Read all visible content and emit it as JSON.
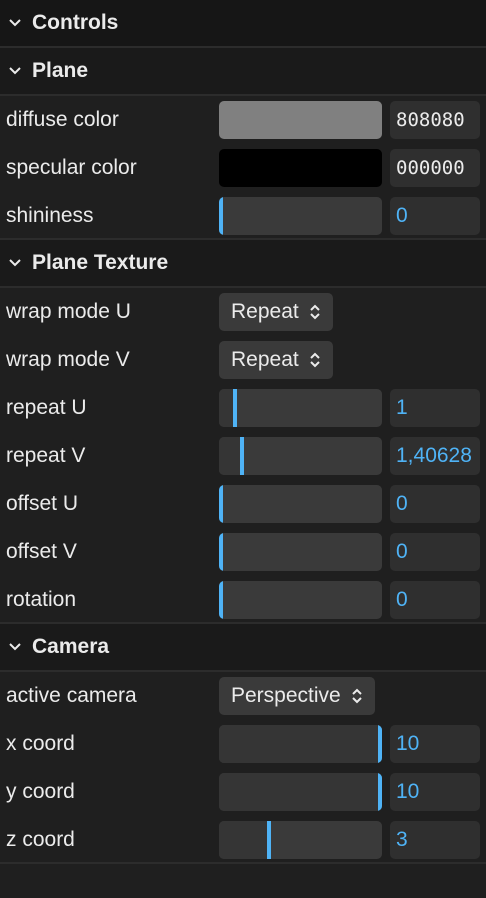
{
  "panel": {
    "title": "Controls"
  },
  "plane": {
    "title": "Plane",
    "diffuse": {
      "label": "diffuse color",
      "color": "#808080",
      "hex": "808080"
    },
    "specular": {
      "label": "specular color",
      "color": "#000000",
      "hex": "000000"
    },
    "shininess": {
      "label": "shininess",
      "value": "0",
      "fraction": 0
    }
  },
  "texture": {
    "title": "Plane Texture",
    "wrap_u": {
      "label": "wrap mode U",
      "value": "Repeat"
    },
    "wrap_v": {
      "label": "wrap mode V",
      "value": "Repeat"
    },
    "repeat_u": {
      "label": "repeat U",
      "value": "1",
      "fraction": 0.09
    },
    "repeat_v": {
      "label": "repeat V",
      "value": "1,40628",
      "fraction": 0.13
    },
    "offset_u": {
      "label": "offset U",
      "value": "0",
      "fraction": 0
    },
    "offset_v": {
      "label": "offset V",
      "value": "0",
      "fraction": 0
    },
    "rotation": {
      "label": "rotation",
      "value": "0",
      "fraction": 0
    }
  },
  "camera": {
    "title": "Camera",
    "active": {
      "label": "active camera",
      "value": "Perspective"
    },
    "x": {
      "label": "x coord",
      "value": "10",
      "fraction": 1
    },
    "y": {
      "label": "y coord",
      "value": "10",
      "fraction": 1
    },
    "z": {
      "label": "z coord",
      "value": "3",
      "fraction": 0.3
    }
  },
  "colors": {
    "accent": "#4fb3f6",
    "background": "#1f1f1f"
  }
}
